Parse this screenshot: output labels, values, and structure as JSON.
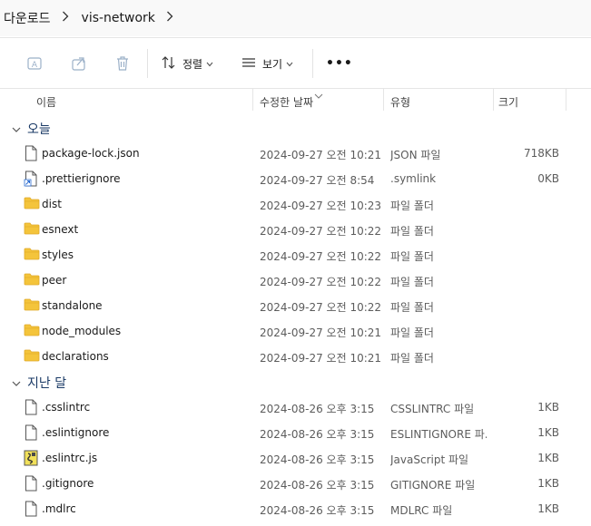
{
  "breadcrumb": {
    "items": [
      "다운로드",
      "vis-network"
    ]
  },
  "toolbar": {
    "sort_label": "정렬",
    "view_label": "보기",
    "more_label": "•••"
  },
  "columns": {
    "name": "이름",
    "date": "수정한 날짜",
    "type": "유형",
    "size": "크기"
  },
  "groups": [
    {
      "label": "오늘"
    },
    {
      "label": "지난 달"
    }
  ],
  "rows": [
    {
      "icon": "file-icon",
      "name": "package-lock.json",
      "date": "2024-09-27 오전 10:21",
      "type": "JSON 파일",
      "size": "718KB"
    },
    {
      "icon": "symlink-file-icon",
      "name": ".prettierignore",
      "date": "2024-09-27 오전 8:54",
      "type": ".symlink",
      "size": "0KB"
    },
    {
      "icon": "folder-icon",
      "name": "dist",
      "date": "2024-09-27 오전 10:23",
      "type": "파일 폴더",
      "size": ""
    },
    {
      "icon": "folder-icon",
      "name": "esnext",
      "date": "2024-09-27 오전 10:22",
      "type": "파일 폴더",
      "size": ""
    },
    {
      "icon": "folder-icon",
      "name": "styles",
      "date": "2024-09-27 오전 10:22",
      "type": "파일 폴더",
      "size": ""
    },
    {
      "icon": "folder-icon",
      "name": "peer",
      "date": "2024-09-27 오전 10:22",
      "type": "파일 폴더",
      "size": ""
    },
    {
      "icon": "folder-icon",
      "name": "standalone",
      "date": "2024-09-27 오전 10:22",
      "type": "파일 폴더",
      "size": ""
    },
    {
      "icon": "folder-icon",
      "name": "node_modules",
      "date": "2024-09-27 오전 10:21",
      "type": "파일 폴더",
      "size": ""
    },
    {
      "icon": "folder-icon",
      "name": "declarations",
      "date": "2024-09-27 오전 10:21",
      "type": "파일 폴더",
      "size": ""
    },
    {
      "icon": "file-icon",
      "name": ".csslintrc",
      "date": "2024-08-26 오후 3:15",
      "type": "CSSLINTRC 파일",
      "size": "1KB"
    },
    {
      "icon": "file-icon",
      "name": ".eslintignore",
      "date": "2024-08-26 오후 3:15",
      "type": "ESLINTIGNORE 파...",
      "size": "1KB"
    },
    {
      "icon": "js-file-icon",
      "name": ".eslintrc.js",
      "date": "2024-08-26 오후 3:15",
      "type": "JavaScript 파일",
      "size": "1KB"
    },
    {
      "icon": "file-icon",
      "name": ".gitignore",
      "date": "2024-08-26 오후 3:15",
      "type": "GITIGNORE 파일",
      "size": "1KB"
    },
    {
      "icon": "file-icon",
      "name": ".mdlrc",
      "date": "2024-08-26 오후 3:15",
      "type": "MDLRC 파일",
      "size": "1KB"
    }
  ],
  "colors": {
    "folder": "#f4c43b",
    "folder_dark": "#e0a928",
    "group_label": "#1a3a66",
    "disabled_icon": "#9bb0c8"
  }
}
